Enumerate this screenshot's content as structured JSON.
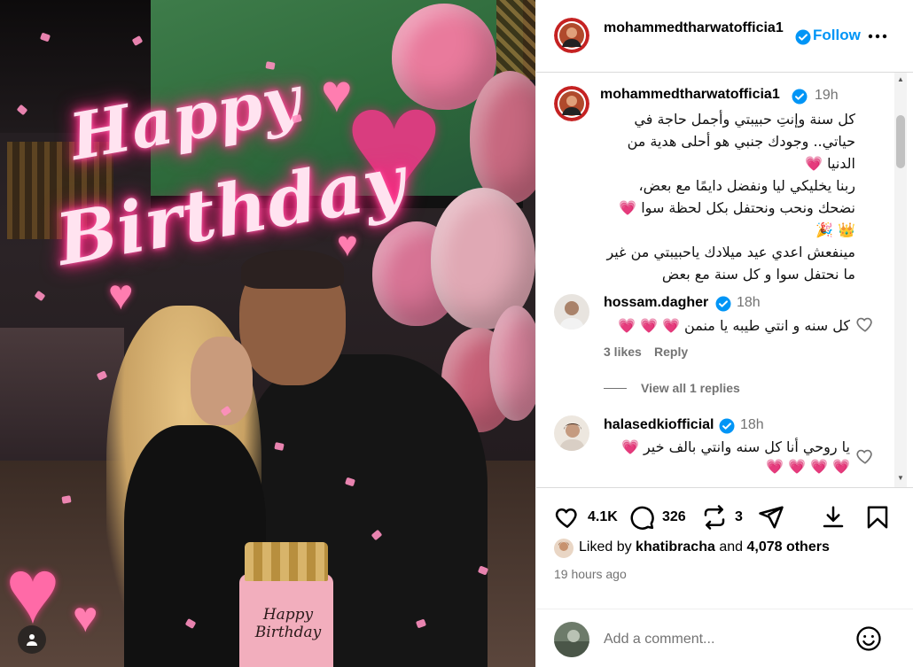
{
  "photo": {
    "overlay_line1": "Happy",
    "overlay_line2": "Birthday",
    "cake_line1": "Happy",
    "cake_line2": "Birthday"
  },
  "header": {
    "username": "mohammedtharwatofficia1",
    "follow_label": "Follow"
  },
  "caption": {
    "username": "mohammedtharwatofficia1",
    "time": "19h",
    "lines": [
      "كل سنة وإنتِ حبيبتي وأجمل حاجة في",
      "حياتي.. وجودك جنبي هو أحلى هدية من",
      "الدنيا 💗",
      "ربنا يخليكي ليا ونفضل دايمًا مع بعض،",
      "نضحك ونحب ونحتفل بكل لحظة سوا 💗",
      "👑 🎉",
      "مينفعش اعدي عيد ميلادك ياحبيبتي من غير",
      "ما نحتفل سوا و كل سنة مع بعض"
    ]
  },
  "comments": [
    {
      "username": "hossam.dagher",
      "time": "18h",
      "text": "كل سنه و انتي طيبه يا منمن 💗 💗 💗",
      "likes": "3 likes",
      "reply_label": "Reply"
    },
    {
      "username": "halasedkiofficial",
      "time": "18h",
      "text_line1": "يا روحي أنا كل سنه وانتي بالف خير 💗",
      "text_line2": "💗 💗 💗 💗"
    }
  ],
  "view_replies_label": "View all 1 replies",
  "actions": {
    "like_count": "4.1K",
    "comment_count": "326",
    "repost_count": "3"
  },
  "liked_by": {
    "prefix": "Liked by",
    "user": "khatibracha",
    "middle": "and",
    "others": "4,078 others"
  },
  "posted_ago": "19 hours ago",
  "comment_input": {
    "placeholder": "Add a comment..."
  },
  "colors": {
    "link_blue": "#0095f6",
    "verified_blue": "#0095f6",
    "muted": "#737373",
    "heart": "#ed1c5a"
  }
}
